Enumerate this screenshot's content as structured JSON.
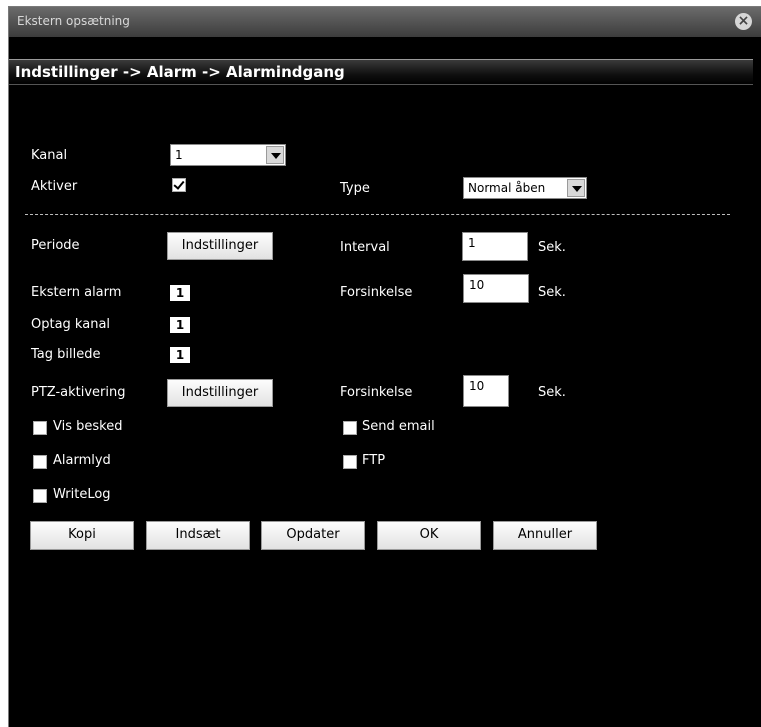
{
  "window": {
    "title": "Ekstern opsætning",
    "close_icon": "×"
  },
  "breadcrumb": "Indstillinger -> Alarm -> Alarmindgang",
  "kanal": {
    "label": "Kanal",
    "value": "1"
  },
  "aktiver": {
    "label": "Aktiver",
    "checked": true
  },
  "type": {
    "label": "Type",
    "value": "Normal åben"
  },
  "periode": {
    "label": "Periode",
    "button": "Indstillinger"
  },
  "interval": {
    "label": "Interval",
    "value": "1",
    "unit": "Sek."
  },
  "ekstern_alarm": {
    "label": "Ekstern alarm",
    "value": "1"
  },
  "forsinkelse1": {
    "label": "Forsinkelse",
    "value": "10",
    "unit": "Sek."
  },
  "optag_kanal": {
    "label": "Optag kanal",
    "value": "1"
  },
  "tag_billede": {
    "label": "Tag billede",
    "value": "1"
  },
  "ptz": {
    "label": "PTZ-aktivering",
    "button": "Indstillinger"
  },
  "forsinkelse2": {
    "label": "Forsinkelse",
    "value": "10",
    "unit": "Sek."
  },
  "checkboxes": {
    "vis_besked": "Vis besked",
    "send_email": "Send email",
    "alarmlyd": "Alarmlyd",
    "ftp": "FTP",
    "writelog": "WriteLog"
  },
  "actions": {
    "kopi": "Kopi",
    "indsaet": "Indsæt",
    "opdater": "Opdater",
    "ok": "OK",
    "annuller": "Annuller"
  }
}
